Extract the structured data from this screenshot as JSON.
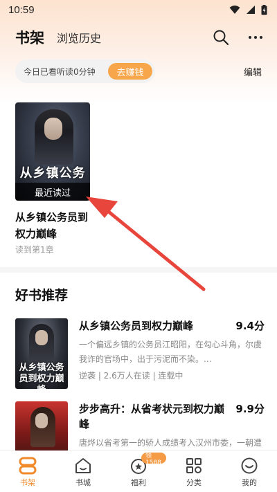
{
  "status_bar": {
    "time": "10:59"
  },
  "header": {
    "tab_shelf": "书架",
    "tab_history": "浏览历史"
  },
  "reading_bar": {
    "text": "今日已看听读0分钟",
    "earn_label": "去赚钱"
  },
  "edit_label": "编辑",
  "shelf": {
    "book": {
      "cover_title": "从乡镇公务",
      "badge": "最近读过",
      "title": "从乡镇公务员到权力巅峰",
      "progress": "读到第1章"
    }
  },
  "recommend": {
    "title": "好书推荐",
    "items": [
      {
        "cover_title": "从乡镇公务员到权力巅峰",
        "name": "从乡镇公务员到权力巅峰",
        "score": "9.4分",
        "desc": "一个偏远乡镇的公务员江昭阳，在勾心斗角，尔虞我诈的官场中，出于污泥而不染。...",
        "meta": "逆袭 | 2.6万人在读 | 连载中"
      },
      {
        "cover_title": "",
        "name": "步步高升：从省考状元到权力巅峰",
        "score": "9.9分",
        "desc": "唐烨以省考第一的骄人成绩考入汉州市委，一朝遭同僚嫉恨被发配基层..."
      }
    ]
  },
  "nav": {
    "items": [
      {
        "label": "书架",
        "icon": "bookshelf-icon"
      },
      {
        "label": "书城",
        "icon": "home-icon"
      },
      {
        "label": "福利",
        "icon": "gift-icon",
        "badge": "领1588"
      },
      {
        "label": "分类",
        "icon": "grid-icon"
      },
      {
        "label": "我的",
        "icon": "smile-icon"
      }
    ]
  },
  "colors": {
    "accent": "#f08a2a",
    "earn_button": "#f7a64b",
    "arrow": "#e8453c"
  }
}
